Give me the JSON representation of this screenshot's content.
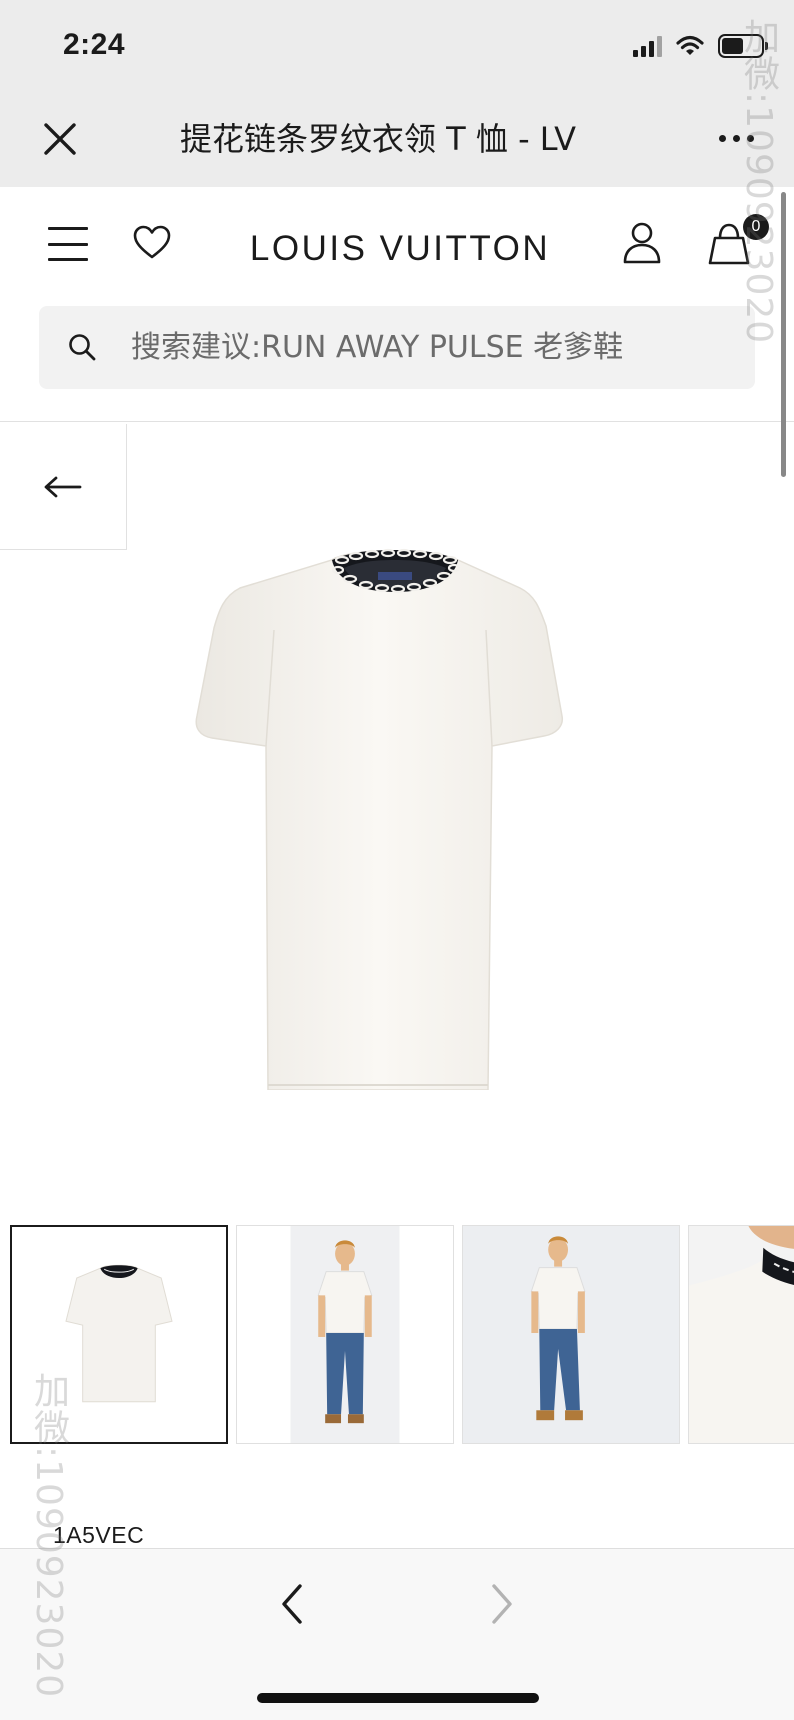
{
  "status_bar": {
    "time": "2:24",
    "battery_level": 0.55
  },
  "browser": {
    "title": "提花链条罗纹衣领 T 恤 - LV",
    "close_icon": "close-icon",
    "more_icon": "more-icon"
  },
  "header": {
    "logo": "LOUIS VUITTON",
    "cart_count": "0",
    "icons": [
      "menu-icon",
      "heart-icon",
      "user-icon",
      "shopping-bag-icon"
    ]
  },
  "search": {
    "placeholder": "搜索建议:RUN AWAY PULSE 老爹鞋"
  },
  "gallery": {
    "back_icon": "arrow-left-icon",
    "thumbnails": [
      "t-shirt-front",
      "model-front",
      "model-front-2",
      "collar-detail"
    ],
    "active_thumbnail": 0
  },
  "product": {
    "code": "1A5VEC"
  },
  "bottom_nav": {
    "back_icon": "chevron-left-icon",
    "forward_icon": "chevron-right-icon"
  },
  "watermark": {
    "top_right": "加微:1090923020",
    "bottom_left": "加微:1090923020"
  },
  "colors": {
    "status_bg": "#ececec",
    "text": "#1b1b1b",
    "search_bg": "#f2f2f2",
    "shirt": "#f7f5f1",
    "collar": "#15171c"
  }
}
